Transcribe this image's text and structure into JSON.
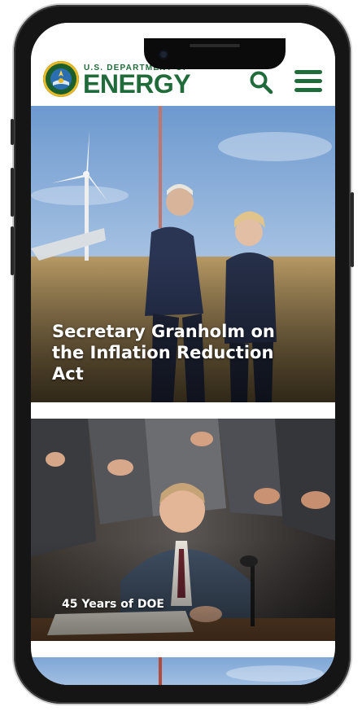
{
  "header": {
    "agency_top": "U.S. DEPARTMENT OF",
    "agency_main": "ENERGY",
    "brand_color": "#1f6b3a",
    "search_icon": "search-icon",
    "menu_icon": "hamburger-menu-icon"
  },
  "cards": [
    {
      "title": "Secretary Granholm on the Inflation Reduction Act"
    },
    {
      "title": "45 Years of DOE"
    }
  ]
}
